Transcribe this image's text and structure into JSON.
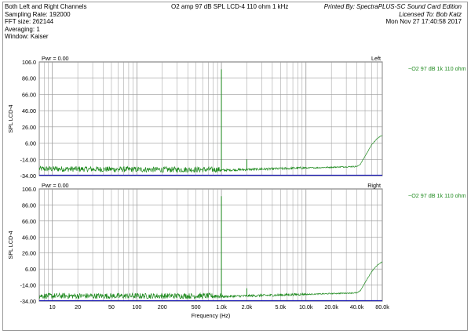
{
  "header": {
    "left_lines": [
      "Both Left and Right Channels",
      "Sampling Rate: 192000",
      "FFT size: 262144",
      "Averaging: 1",
      "Window: Kaiser"
    ],
    "center_title": "O2 amp 97 dB SPL LCD-4 110 ohm 1 kHz",
    "printed_by": "Printed By: SpectraPLUS-SC Sound Card Edition",
    "licensed_to": "Licensed To: Bob Katz",
    "date": "Mon Nov 27 17:40:58 2017"
  },
  "colors": {
    "trace": "#1f8a1f",
    "grid": "#9a9a9a",
    "baseline": "#1b1bb4",
    "plot_border": "#6e6e6e"
  },
  "chart_data": [
    {
      "type": "line",
      "channel_label": "Left",
      "pwr_label": "Pwr = 0.00",
      "ylabel": "SPL LCD-4",
      "xlabel": "",
      "legend": "~O2 97 dB 1k 110 ohm",
      "legend_placement": "right-outside",
      "xscale": "log",
      "xlim": [
        7,
        80000
      ],
      "ylim": [
        -34,
        106
      ],
      "yticks": [
        "106.0",
        "86.00",
        "66.00",
        "46.00",
        "26.00",
        "6.00",
        "-14.00",
        "-34.00"
      ],
      "grid": true,
      "series": [
        {
          "name": "~O2 97 dB 1k 110 ohm",
          "noise_floor": [
            [
              7,
              -27
            ],
            [
              200,
              -28
            ],
            [
              1000,
              -28
            ],
            [
              5000,
              -26
            ],
            [
              20000,
              -24
            ],
            [
              40000,
              -23
            ]
          ],
          "rise": [
            [
              40000,
              -23
            ],
            [
              44000,
              -20
            ],
            [
              50000,
              -10
            ],
            [
              60000,
              4
            ],
            [
              70000,
              12
            ],
            [
              80000,
              16
            ]
          ],
          "spikes": [
            [
              1000,
              97
            ],
            [
              2000,
              -14
            ],
            [
              3000,
              -24
            ],
            [
              5000,
              -26
            ],
            [
              120,
              -26
            ],
            [
              60,
              -29
            ]
          ]
        }
      ]
    },
    {
      "type": "line",
      "channel_label": "Right",
      "pwr_label": "Pwr = 0.00",
      "ylabel": "SPL LCD-4",
      "xlabel": "Frequency (Hz)",
      "legend": "~O2 97 dB 1k 110 ohm",
      "legend_placement": "right-outside",
      "xscale": "log",
      "xlim": [
        7,
        80000
      ],
      "ylim": [
        -34,
        106
      ],
      "yticks": [
        "106.0",
        "86.00",
        "66.00",
        "46.00",
        "26.00",
        "6.00",
        "-14.00",
        "-34.00"
      ],
      "xticks": [
        {
          "value": 10,
          "label": "10"
        },
        {
          "value": 20,
          "label": "20"
        },
        {
          "value": 50,
          "label": "50"
        },
        {
          "value": 100,
          "label": "100"
        },
        {
          "value": 200,
          "label": "200"
        },
        {
          "value": 500,
          "label": "500"
        },
        {
          "value": 1000,
          "label": "1.0k"
        },
        {
          "value": 2000,
          "label": "2.0k"
        },
        {
          "value": 5000,
          "label": "5.0k"
        },
        {
          "value": 10000,
          "label": "10.0k"
        },
        {
          "value": 20000,
          "label": "20.0k"
        },
        {
          "value": 40000,
          "label": "40.0k"
        },
        {
          "value": 80000,
          "label": "80.0k"
        }
      ],
      "grid": true,
      "series": [
        {
          "name": "~O2 97 dB 1k 110 ohm",
          "noise_floor": [
            [
              7,
              -29
            ],
            [
              200,
              -29
            ],
            [
              1000,
              -29
            ],
            [
              5000,
              -27
            ],
            [
              20000,
              -25
            ],
            [
              40000,
              -24
            ]
          ],
          "rise": [
            [
              40000,
              -24
            ],
            [
              44000,
              -21
            ],
            [
              50000,
              -11
            ],
            [
              60000,
              3
            ],
            [
              70000,
              11
            ],
            [
              80000,
              15
            ]
          ],
          "spikes": [
            [
              1000,
              97
            ],
            [
              2000,
              -18
            ],
            [
              3000,
              -25
            ],
            [
              5000,
              -27
            ],
            [
              60,
              -30
            ]
          ]
        }
      ]
    }
  ]
}
